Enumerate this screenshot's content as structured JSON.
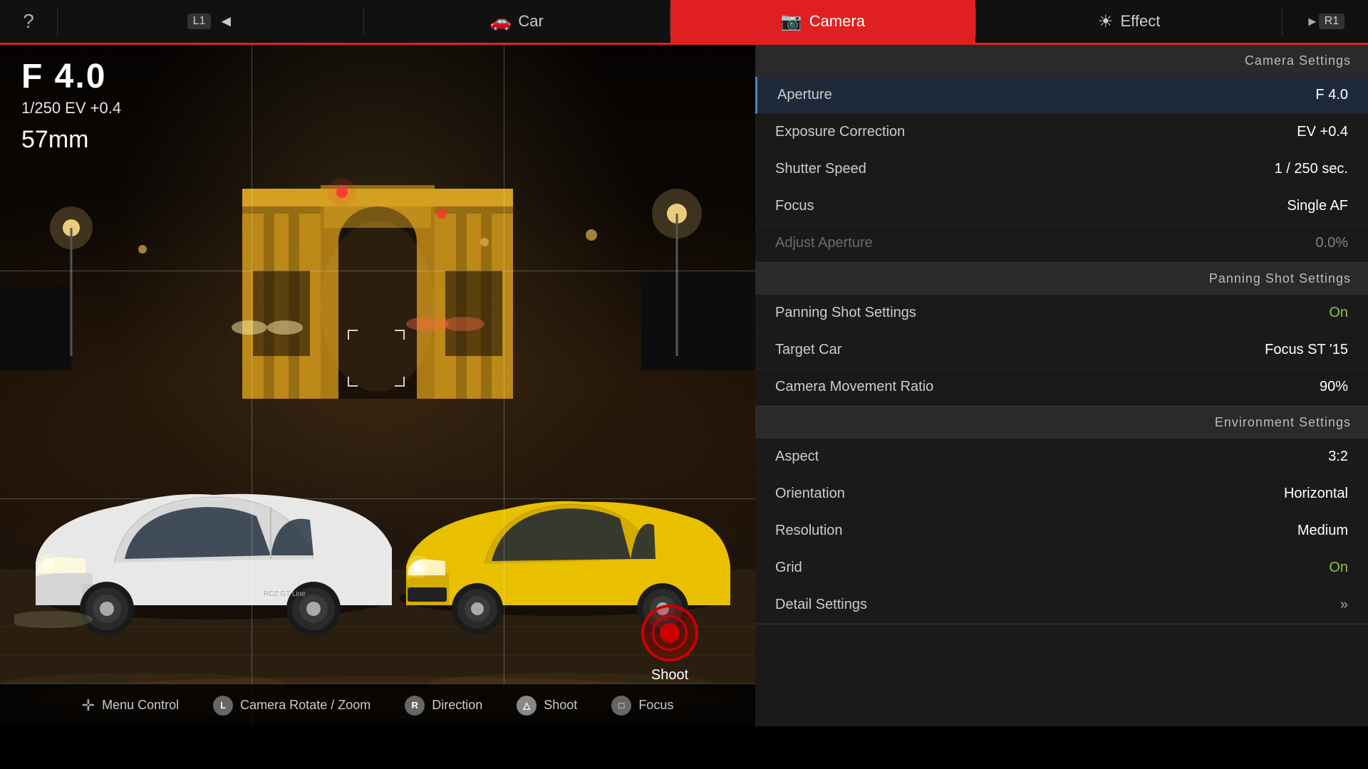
{
  "nav": {
    "help_icon": "?",
    "l1_label": "L1",
    "l1_arrow": "◄",
    "car_icon": "🚗",
    "car_label": "Car",
    "camera_icon": "📷",
    "camera_label": "Camera",
    "effect_icon": "☀",
    "effect_label": "Effect",
    "r1_arrow": "►",
    "r1_label": "R1"
  },
  "camera_info": {
    "aperture": "F 4.0",
    "shutter_ev": "1/250   EV +0.4",
    "focal_length": "57mm"
  },
  "shoot_button": {
    "label": "Shoot"
  },
  "bottom_bar": {
    "items": [
      {
        "badge": "✛",
        "badge_type": "dpad",
        "label": "Menu Control"
      },
      {
        "badge": "L",
        "badge_color": "#888",
        "label": "Camera Rotate / Zoom"
      },
      {
        "badge": "R",
        "badge_color": "#888",
        "label": "Direction"
      },
      {
        "badge": "△",
        "badge_color": "#888",
        "label": "Shoot"
      },
      {
        "badge": "□",
        "badge_color": "#888",
        "label": "Focus"
      }
    ]
  },
  "right_panel": {
    "sections": [
      {
        "id": "camera_settings",
        "header": "Camera Settings",
        "rows": [
          {
            "label": "Aperture",
            "value": "F 4.0",
            "highlighted": true,
            "dimmed": false
          },
          {
            "label": "Exposure Correction",
            "value": "EV +0.4",
            "highlighted": false,
            "dimmed": false
          },
          {
            "label": "Shutter Speed",
            "value": "1 / 250 sec.",
            "highlighted": false,
            "dimmed": false
          },
          {
            "label": "Focus",
            "value": "Single AF",
            "highlighted": false,
            "dimmed": false
          },
          {
            "label": "Adjust Aperture",
            "value": "0.0%",
            "highlighted": false,
            "dimmed": true
          }
        ]
      },
      {
        "id": "panning_shot_settings",
        "header": "Panning Shot Settings",
        "rows": [
          {
            "label": "Panning Shot Settings",
            "value": "On",
            "highlighted": false,
            "dimmed": false,
            "value_green": true
          },
          {
            "label": "Target Car",
            "value": "Focus ST '15",
            "highlighted": false,
            "dimmed": false
          },
          {
            "label": "Camera Movement Ratio",
            "value": "90%",
            "highlighted": false,
            "dimmed": false
          }
        ]
      },
      {
        "id": "environment_settings",
        "header": "Environment Settings",
        "rows": [
          {
            "label": "Aspect",
            "value": "3:2",
            "highlighted": false,
            "dimmed": false
          },
          {
            "label": "Orientation",
            "value": "Horizontal",
            "highlighted": false,
            "dimmed": false
          },
          {
            "label": "Resolution",
            "value": "Medium",
            "highlighted": false,
            "dimmed": false
          },
          {
            "label": "Grid",
            "value": "On",
            "highlighted": false,
            "dimmed": false
          },
          {
            "label": "Detail Settings",
            "value": "»",
            "highlighted": false,
            "dimmed": false,
            "is_arrow": true
          }
        ]
      }
    ]
  },
  "scene": {
    "grid_thirds_h": [
      33.33,
      66.66
    ],
    "grid_thirds_v": [
      33.33,
      66.66
    ]
  }
}
